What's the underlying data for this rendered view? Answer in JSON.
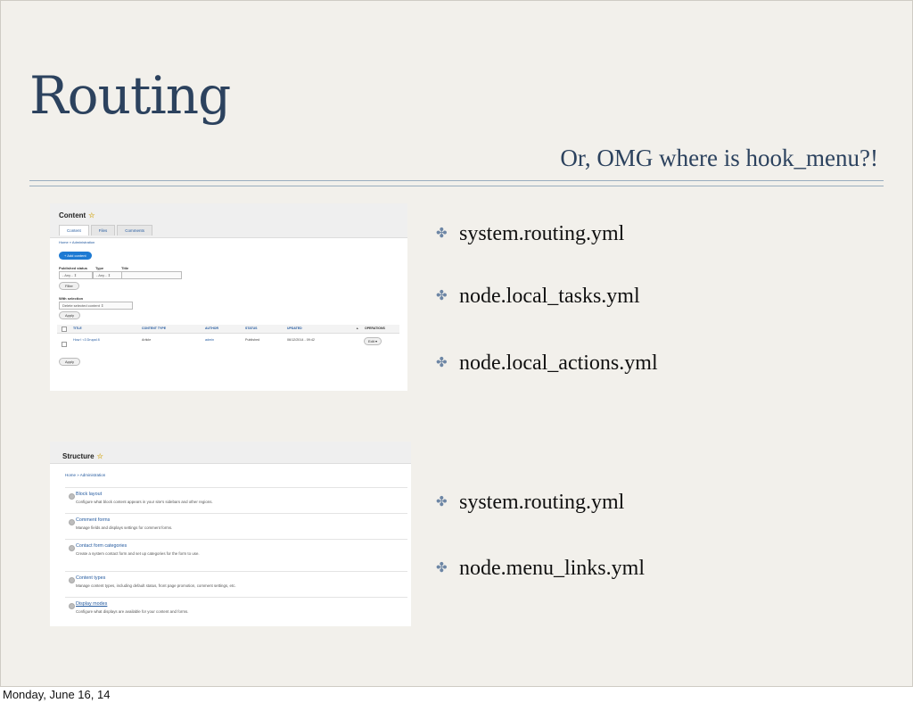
{
  "slide": {
    "title": "Routing",
    "subtitle": "Or, OMG where is hook_menu?!",
    "bullets_top": [
      "system.routing.yml",
      "node.local_tasks.yml",
      "node.local_actions.yml"
    ],
    "bullets_bottom": [
      "system.routing.yml",
      "node.menu_links.yml"
    ]
  },
  "content_screen": {
    "title": "Content",
    "tabs": [
      "Content",
      "Files",
      "Comments"
    ],
    "breadcrumb": "Home » Administration",
    "add_button": "+ Add content",
    "published_label": "Published status",
    "type_label": "Type",
    "title_label": "Title",
    "published_value": "- Any -",
    "type_value": "- Any -",
    "filter_button": "Filter",
    "selection_label": "With selection",
    "selection_value": "Delete selected content",
    "apply_button": "Apply",
    "columns": [
      "TITLE",
      "CONTENT TYPE",
      "AUTHOR",
      "STATUS",
      "UPDATED",
      "OPERATIONS"
    ],
    "row": {
      "title": "How I <3 Drupal 8",
      "type": "Article",
      "author": "admin",
      "status": "Published",
      "updated": "06/12/2014 - 09:42",
      "operation": "Edit"
    },
    "apply_button_bottom": "Apply"
  },
  "structure_screen": {
    "title": "Structure",
    "breadcrumb": "Home » Administration",
    "items": [
      {
        "label": "Block layout",
        "desc": "Configure what block content appears in your site's sidebars and other regions."
      },
      {
        "label": "Comment forms",
        "desc": "Manage fields and displays settings for comment forms."
      },
      {
        "label": "Contact form categories",
        "desc": "Create a system contact form and set up categories for the form to use."
      },
      {
        "label": "Content types",
        "desc": "Manage content types, including default status, front page promotion, comment settings, etc."
      },
      {
        "label": "Display modes",
        "desc": "Configure what displays are available for your content and forms."
      }
    ]
  },
  "footer": {
    "date": "Monday, June 16, 14"
  },
  "colors": {
    "title": "#2c425e",
    "background": "#f2f0eb",
    "link": "#245a9f",
    "button": "#1d7ad3"
  }
}
